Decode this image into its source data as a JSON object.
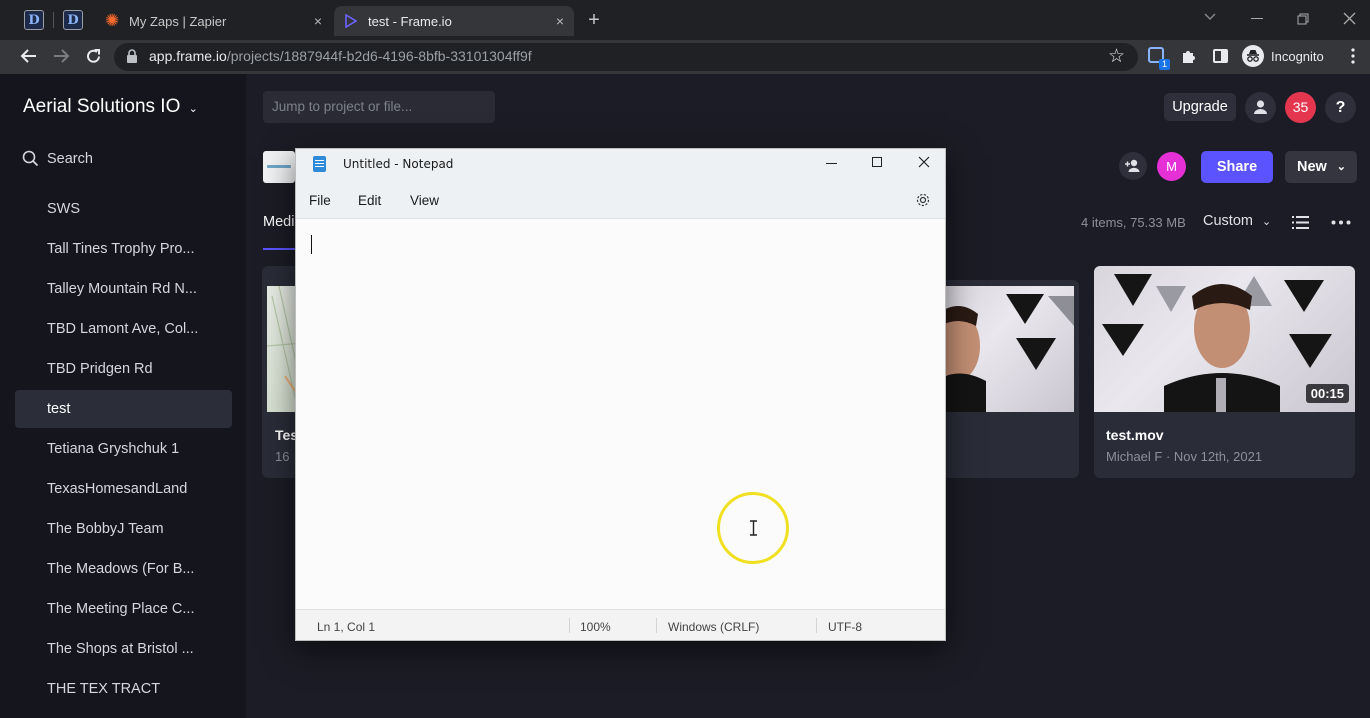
{
  "browser": {
    "pinned_tabs": [
      "D",
      "D"
    ],
    "tabs": [
      {
        "title": "My Zaps | Zapier",
        "close": "×"
      },
      {
        "title": "test - Frame.io",
        "close": "×"
      }
    ],
    "new_tab": "+",
    "url_host": "app.frame.io",
    "url_path": "/projects/1887944f-b2d6-4196-8bfb-33101304ff9f",
    "extension_badge": "1",
    "incognito_label": "Incognito"
  },
  "app": {
    "team_name": "Aerial Solutions IO",
    "search_label": "Search",
    "projects": [
      "SWS",
      "Tall Tines Trophy Pro...",
      "Talley Mountain Rd N...",
      "TBD Lamont Ave, Col...",
      "TBD Pridgen Rd",
      "test",
      "Tetiana Gryshchuk 1",
      "TexasHomesandLand",
      "The BobbyJ Team",
      "The Meadows (For B...",
      "The Meeting Place C...",
      "The Shops at Bristol ...",
      "THE TEX TRACT"
    ],
    "active_project": "test",
    "jump_placeholder": "Jump to project or file...",
    "upgrade_label": "Upgrade",
    "notification_count": "35",
    "help_label": "?",
    "member_initial": "M",
    "share_label": "Share",
    "new_label": "New",
    "media_tab": "Media",
    "items_summary": "4 items, 75.33 MB",
    "sort_label": "Custom",
    "assets": [
      {
        "name": "Tes",
        "meta": "16"
      },
      {
        "name": "test.mov",
        "meta": "Michael F · Nov 12th, 2021",
        "duration": "00:15"
      }
    ]
  },
  "notepad": {
    "title": "Untitled - Notepad",
    "menu": [
      "File",
      "Edit",
      "View"
    ],
    "content": "",
    "status": {
      "position": "Ln 1, Col 1",
      "zoom": "100%",
      "line_ending": "Windows (CRLF)",
      "encoding": "UTF-8"
    }
  },
  "colors": {
    "accent": "#5b53ff",
    "notification": "#e5364f",
    "avatar": "#e530d6",
    "cursor_highlight": "#f0e020"
  }
}
